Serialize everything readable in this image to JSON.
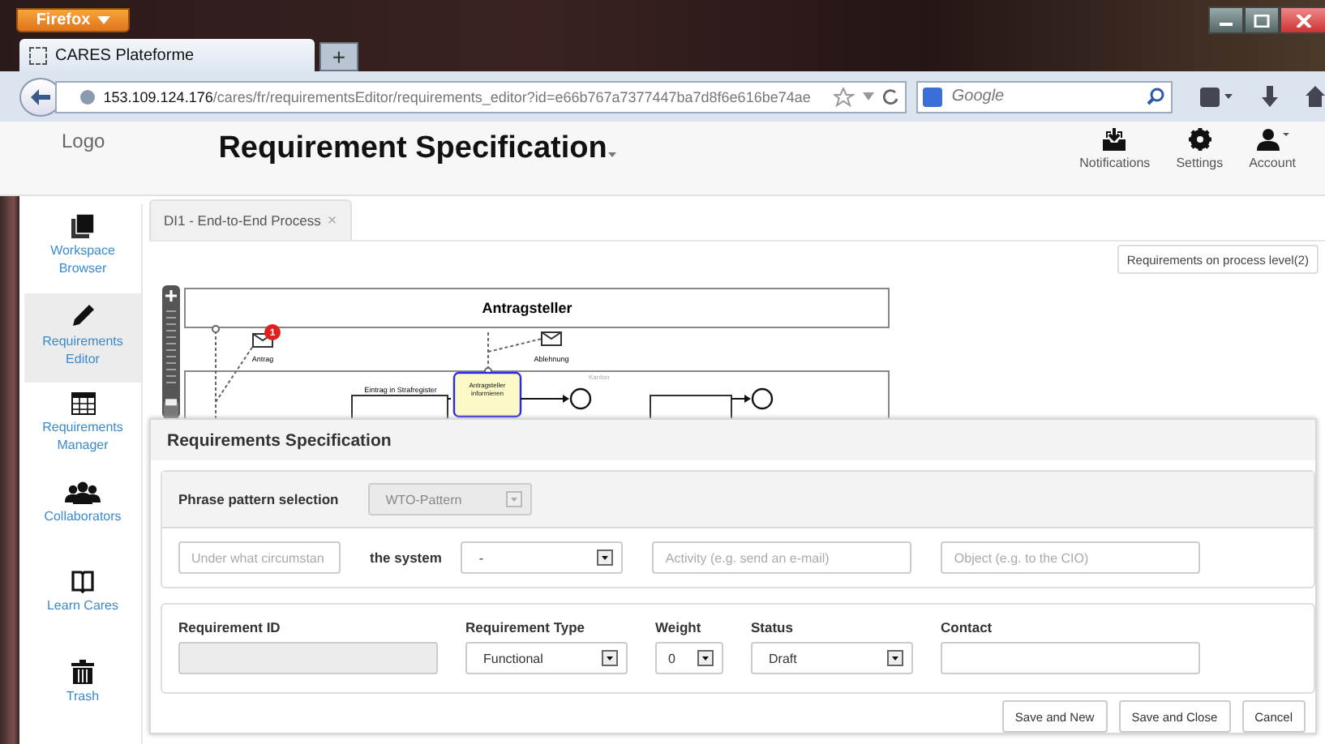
{
  "browser": {
    "menu_button": "Firefox",
    "tab_title": "CARES Plateforme",
    "new_tab": "+",
    "url_host": "153.109.124.176",
    "url_path": "/cares/fr/requirementsEditor/requirements_editor?id=e66b767a7377447ba7d8f6e616be74ae",
    "search_placeholder": "Google"
  },
  "header": {
    "logo": "Logo",
    "title": "Requirement Specification",
    "actions": [
      {
        "label": "Notifications"
      },
      {
        "label": "Settings"
      },
      {
        "label": "Account"
      }
    ]
  },
  "sidebar": [
    {
      "label": "Workspace Browser",
      "selected": false
    },
    {
      "label": "Requirements Editor",
      "selected": true
    },
    {
      "label": "Requirements Manager",
      "selected": false
    },
    {
      "label": "Collaborators",
      "selected": false
    },
    {
      "label": "Learn Cares",
      "selected": false
    },
    {
      "label": "Trash",
      "selected": false
    }
  ],
  "tab": {
    "label": "DI1 - End-to-End Process",
    "close": "×"
  },
  "process_button": "Requirements on process level(2)",
  "diagram": {
    "zoom": {
      "level": 0.12
    },
    "pool": "Antragsteller",
    "badge": "1",
    "message_in": "Antrag",
    "message_out": "Ablehnung",
    "flow_label": "Eintrag in Strafregister",
    "task": "Antragsteller informieren",
    "lane_note": "Kanton"
  },
  "dialog": {
    "title": "Requirements Specification",
    "pattern_label": "Phrase pattern selection",
    "pattern_value": "WTO-Pattern",
    "condition_placeholder": "Under what circumstan",
    "system_label": "the system",
    "system_value": "-",
    "activity_placeholder": "Activity (e.g. send an e-mail)",
    "object_placeholder": "Object (e.g. to the CIO)",
    "fields": [
      {
        "label": "Requirement ID",
        "kind": "disabled"
      },
      {
        "label": "Requirement Type",
        "kind": "select",
        "value": "Functional"
      },
      {
        "label": "Weight",
        "kind": "small-select",
        "value": "0"
      },
      {
        "label": "Status",
        "kind": "select",
        "value": "Draft"
      },
      {
        "label": "Contact",
        "kind": "input"
      }
    ],
    "buttons": [
      "Save and New",
      "Save and Close",
      "Cancel"
    ]
  }
}
